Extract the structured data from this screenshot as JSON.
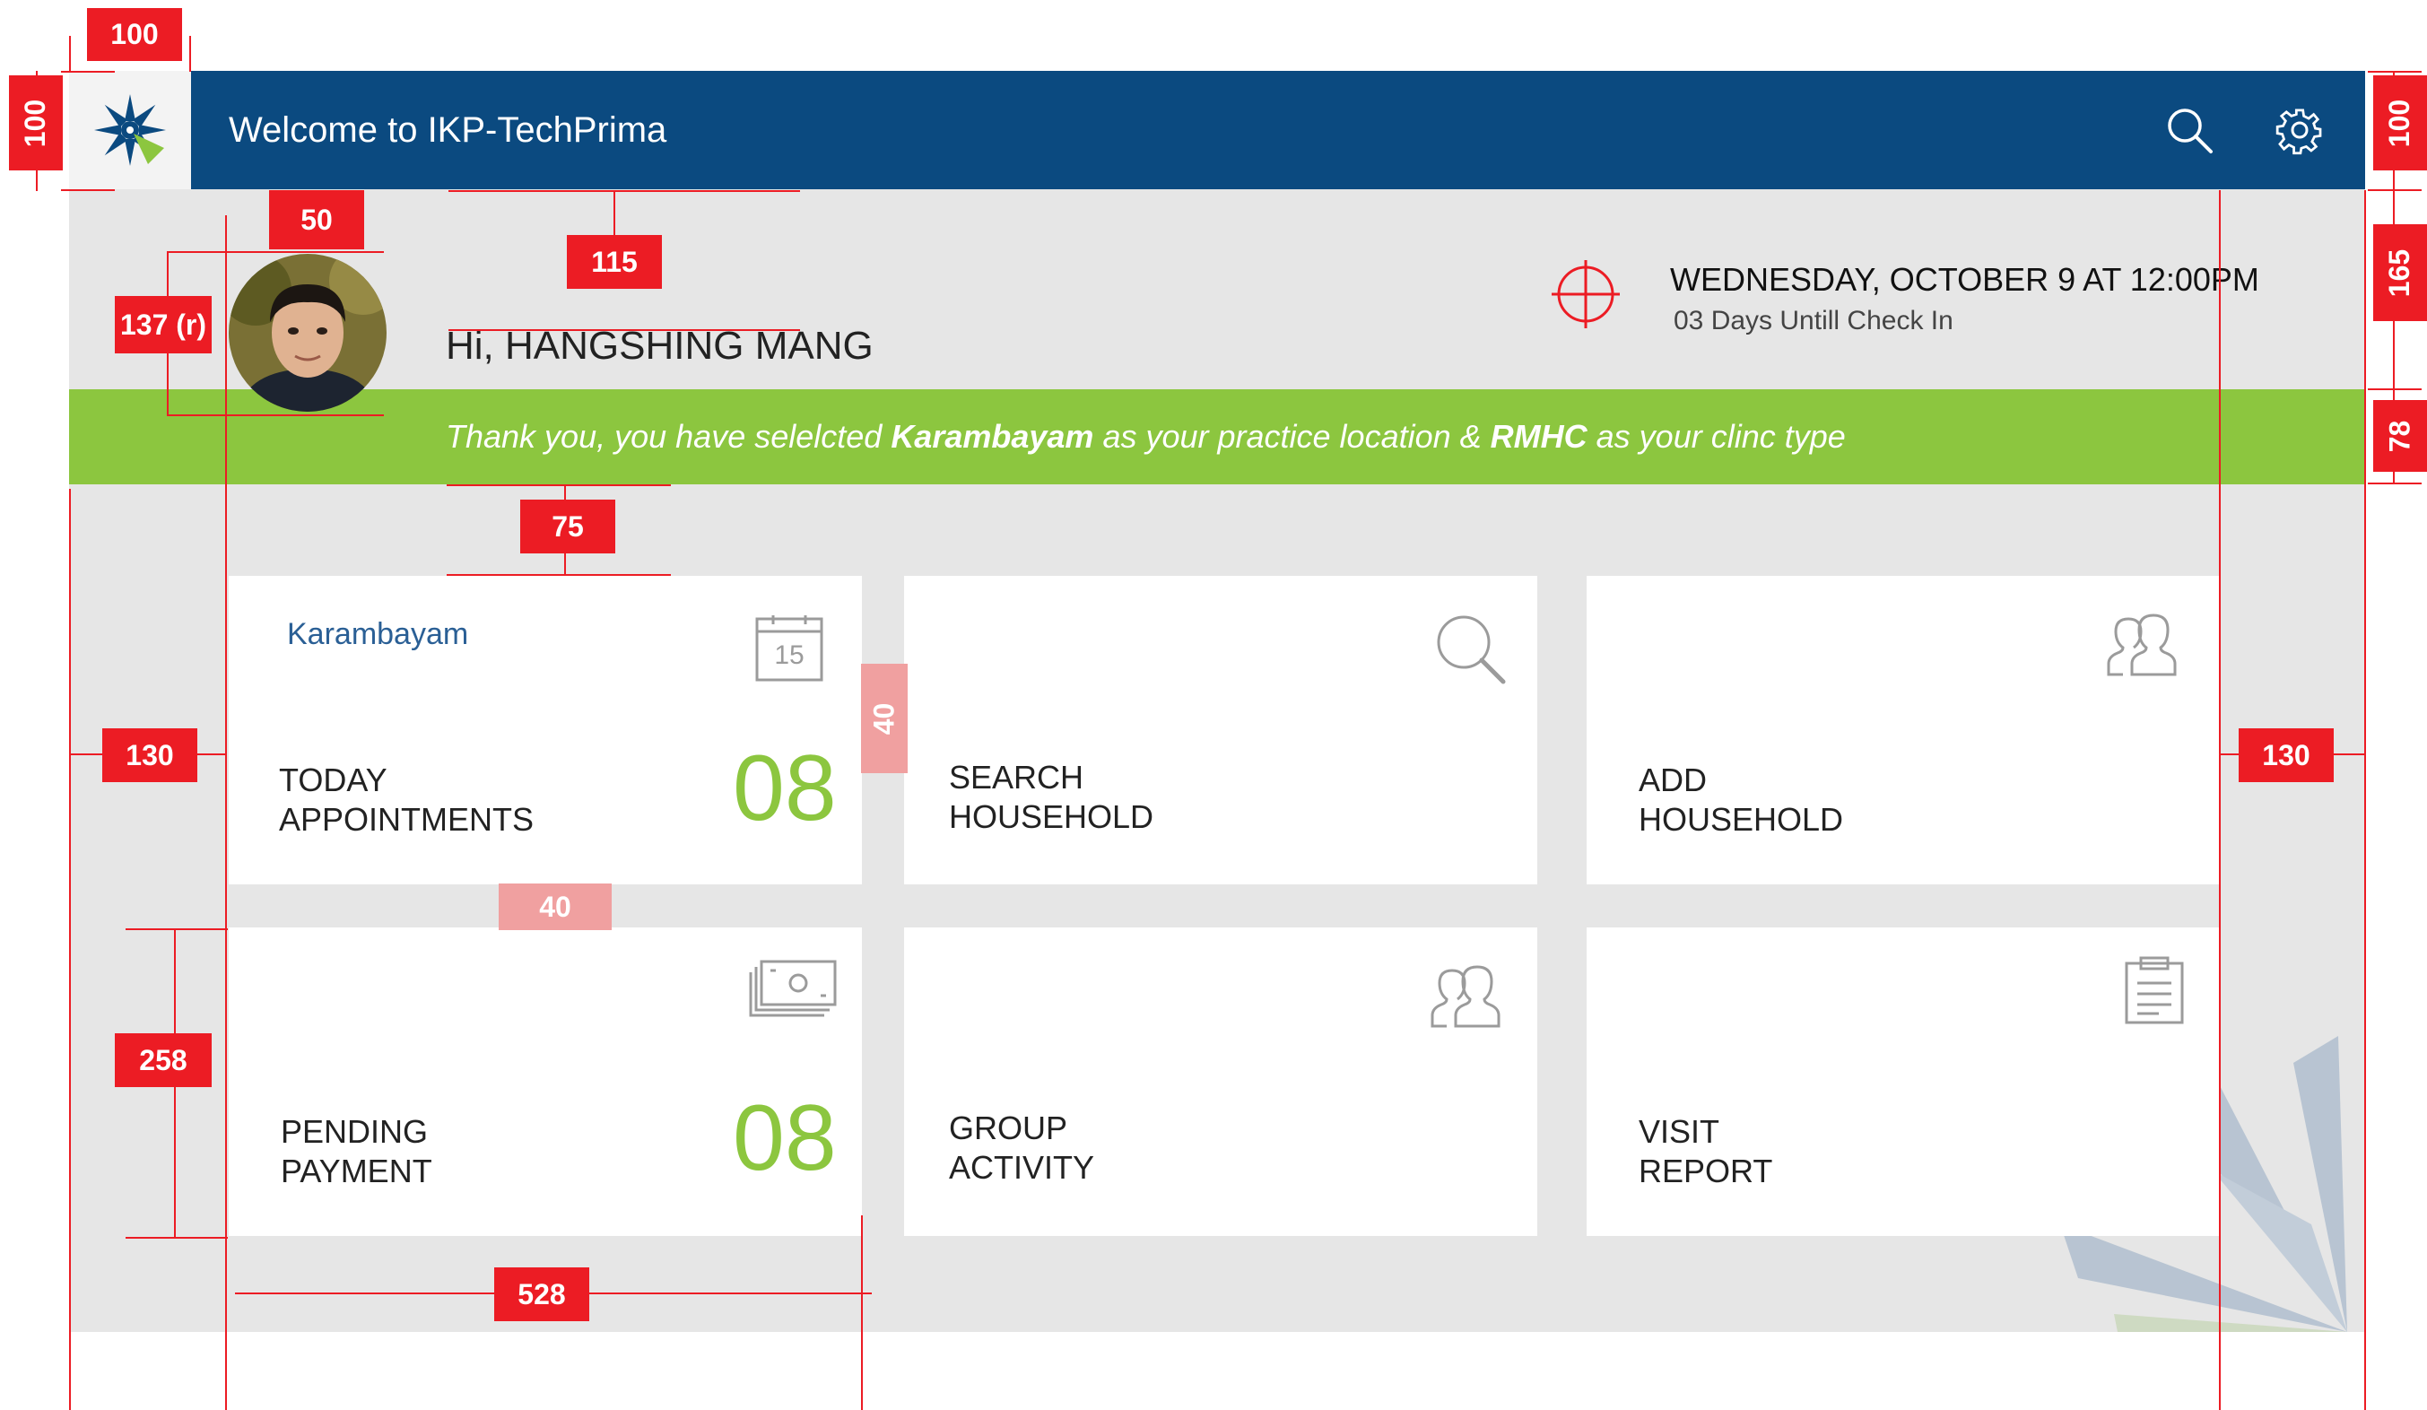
{
  "header": {
    "title": "Welcome to IKP-TechPrima",
    "logo_icon": "snowflake-logo-icon",
    "search_icon": "search-icon",
    "settings_icon": "gear-icon",
    "bg_color": "#0b4a80"
  },
  "user": {
    "greeting": "Hi, HANGSHING MANG",
    "avatar": "user-avatar"
  },
  "checkin": {
    "date": "WEDNESDAY, OCTOBER 9 AT 12:00PM",
    "days_left": "03 Days Untill Check In",
    "icon": "target-icon"
  },
  "banner": {
    "prefix": "Thank you, you have selelcted ",
    "location": "Karambayam",
    "middle": " as your practice location & ",
    "clinic": "RMHC",
    "suffix": " as your clinc type",
    "bg_color": "#8cc63f"
  },
  "tiles": {
    "today": {
      "location": "Karambayam",
      "title_line1": "TODAY",
      "title_line2": "APPOINTMENTS",
      "count": "08",
      "calendar_day": "15",
      "icon": "calendar-icon"
    },
    "search": {
      "title_line1": "SEARCH",
      "title_line2": "HOUSEHOLD",
      "icon": "search-icon"
    },
    "add": {
      "title_line1": "ADD",
      "title_line2": "HOUSEHOLD",
      "icon": "users-icon"
    },
    "payment": {
      "title_line1": "PENDING",
      "title_line2": "PAYMENT",
      "count": "08",
      "icon": "money-icon"
    },
    "group": {
      "title_line1": "GROUP",
      "title_line2": "ACTIVITY",
      "icon": "group-icon"
    },
    "report": {
      "title_line1": "VISIT",
      "title_line2": "REPORT",
      "icon": "clipboard-icon"
    }
  },
  "annotations": {
    "a100_top": "100",
    "a100_left": "100",
    "a100_right": "100",
    "a50": "50",
    "a115": "115",
    "a137": "137 (r)",
    "a165": "165",
    "a78": "78",
    "a75": "75",
    "a130_left": "130",
    "a130_right": "130",
    "a40_v": "40",
    "a40_h": "40",
    "a258": "258",
    "a528": "528"
  },
  "colors": {
    "accent_green": "#8cc63f",
    "brand_blue": "#0b4a80",
    "annotation_red": "#ec1c24",
    "annotation_pink": "#f0a0a0"
  }
}
